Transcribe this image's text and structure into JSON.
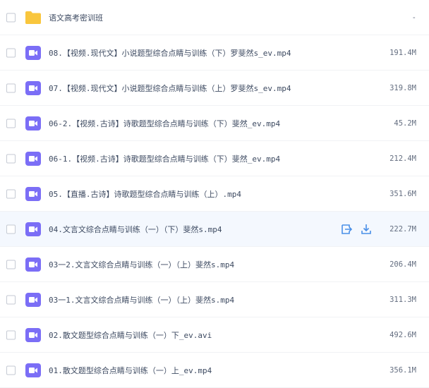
{
  "files": [
    {
      "name": "语文高考密训班",
      "size": "-",
      "type": "folder",
      "hovered": false
    },
    {
      "name": "08.【视频.现代文】小说题型综合点睛与训练（下）罗斐然s_ev.mp4",
      "size": "191.4M",
      "type": "video",
      "hovered": false
    },
    {
      "name": "07.【视频.现代文】小说题型综合点睛与训练（上）罗斐然s_ev.mp4",
      "size": "319.8M",
      "type": "video",
      "hovered": false
    },
    {
      "name": "06-2.【视频.古诗】诗歌题型综合点睛与训练（下）斐然_ev.mp4",
      "size": "45.2M",
      "type": "video",
      "hovered": false
    },
    {
      "name": "06-1.【视频.古诗】诗歌题型综合点睛与训练（下）斐然_ev.mp4",
      "size": "212.4M",
      "type": "video",
      "hovered": false
    },
    {
      "name": "05.【直播.古诗】诗歌题型综合点睛与训练（上）.mp4",
      "size": "351.6M",
      "type": "video",
      "hovered": false
    },
    {
      "name": "04.文言文综合点睛与训练（一）（下）斐然s.mp4",
      "size": "222.7M",
      "type": "video",
      "hovered": true
    },
    {
      "name": "03一2.文言文综合点睛与训练（一）（上）斐然s.mp4",
      "size": "206.4M",
      "type": "video",
      "hovered": false
    },
    {
      "name": "03一1.文言文综合点睛与训练（一）（上）斐然s.mp4",
      "size": "311.3M",
      "type": "video",
      "hovered": false
    },
    {
      "name": "02.散文题型综合点睛与训练（一）下_ev.avi",
      "size": "492.6M",
      "type": "video",
      "hovered": false
    },
    {
      "name": "01.散文题型综合点睛与训练（一）上_ev.mp4",
      "size": "356.1M",
      "type": "video",
      "hovered": false
    }
  ],
  "row_actions": [
    "share-icon",
    "download-icon"
  ],
  "colors": {
    "folder": "#f9c63d",
    "video": "#7b6ef6",
    "action": "#4a8fe7",
    "hover_row": "#f4f8fe"
  }
}
